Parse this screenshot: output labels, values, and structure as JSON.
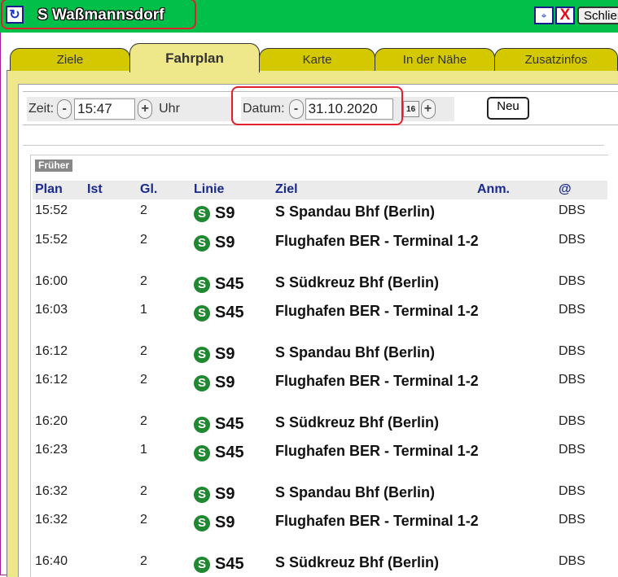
{
  "title": "S Waßmannsdorf",
  "toolbar": {
    "reload_icon": "↻",
    "pin_icon": "⌖",
    "close_icon": "X",
    "close_label": "Schließen"
  },
  "tabs": [
    {
      "label": "Ziele",
      "active": false
    },
    {
      "label": "Fahrplan",
      "active": true
    },
    {
      "label": "Karte",
      "active": false
    },
    {
      "label": "In der Nähe",
      "active": false
    },
    {
      "label": "Zusatzinfos",
      "active": false
    }
  ],
  "controls": {
    "time_label": "Zeit:",
    "time_value": "15:47",
    "time_unit": "Uhr",
    "date_label": "Datum:",
    "date_value": "31.10.2020",
    "calendar_icon": "16",
    "minus": "-",
    "plus": "+",
    "neu_label": "Neu"
  },
  "board": {
    "earlier_label": "Früher",
    "headers": {
      "plan": "Plan",
      "ist": "Ist",
      "gl": "Gl.",
      "linie": "Linie",
      "ziel": "Ziel",
      "anm": "Anm.",
      "at": "@"
    },
    "rows": [
      {
        "plan": "15:52",
        "gl": "2",
        "linie": "S9",
        "ziel": "S Spandau Bhf (Berlin)",
        "at": "DBS"
      },
      {
        "plan": "15:52",
        "gl": "2",
        "linie": "S9",
        "ziel": "Flughafen BER - Terminal 1-2",
        "at": "DBS"
      },
      {
        "plan": "16:00",
        "gl": "2",
        "linie": "S45",
        "ziel": "S Südkreuz Bhf (Berlin)",
        "at": "DBS"
      },
      {
        "plan": "16:03",
        "gl": "1",
        "linie": "S45",
        "ziel": "Flughafen BER - Terminal 1-2",
        "at": "DBS"
      },
      {
        "plan": "16:12",
        "gl": "2",
        "linie": "S9",
        "ziel": "S Spandau Bhf (Berlin)",
        "at": "DBS"
      },
      {
        "plan": "16:12",
        "gl": "2",
        "linie": "S9",
        "ziel": "Flughafen BER - Terminal 1-2",
        "at": "DBS"
      },
      {
        "plan": "16:20",
        "gl": "2",
        "linie": "S45",
        "ziel": "S Südkreuz Bhf (Berlin)",
        "at": "DBS"
      },
      {
        "plan": "16:23",
        "gl": "1",
        "linie": "S45",
        "ziel": "Flughafen BER - Terminal 1-2",
        "at": "DBS"
      },
      {
        "plan": "16:32",
        "gl": "2",
        "linie": "S9",
        "ziel": "S Spandau Bhf (Berlin)",
        "at": "DBS"
      },
      {
        "plan": "16:32",
        "gl": "2",
        "linie": "S9",
        "ziel": "Flughafen BER - Terminal 1-2",
        "at": "DBS"
      },
      {
        "plan": "16:40",
        "gl": "2",
        "linie": "S45",
        "ziel": "S Südkreuz Bhf (Berlin)",
        "at": "DBS"
      }
    ]
  },
  "colors": {
    "titlebar": "#00c04a",
    "tab": "#d4c800",
    "tab_active": "#eee88a",
    "header_text": "#1a2a8c",
    "highlight": "#e0202a"
  }
}
